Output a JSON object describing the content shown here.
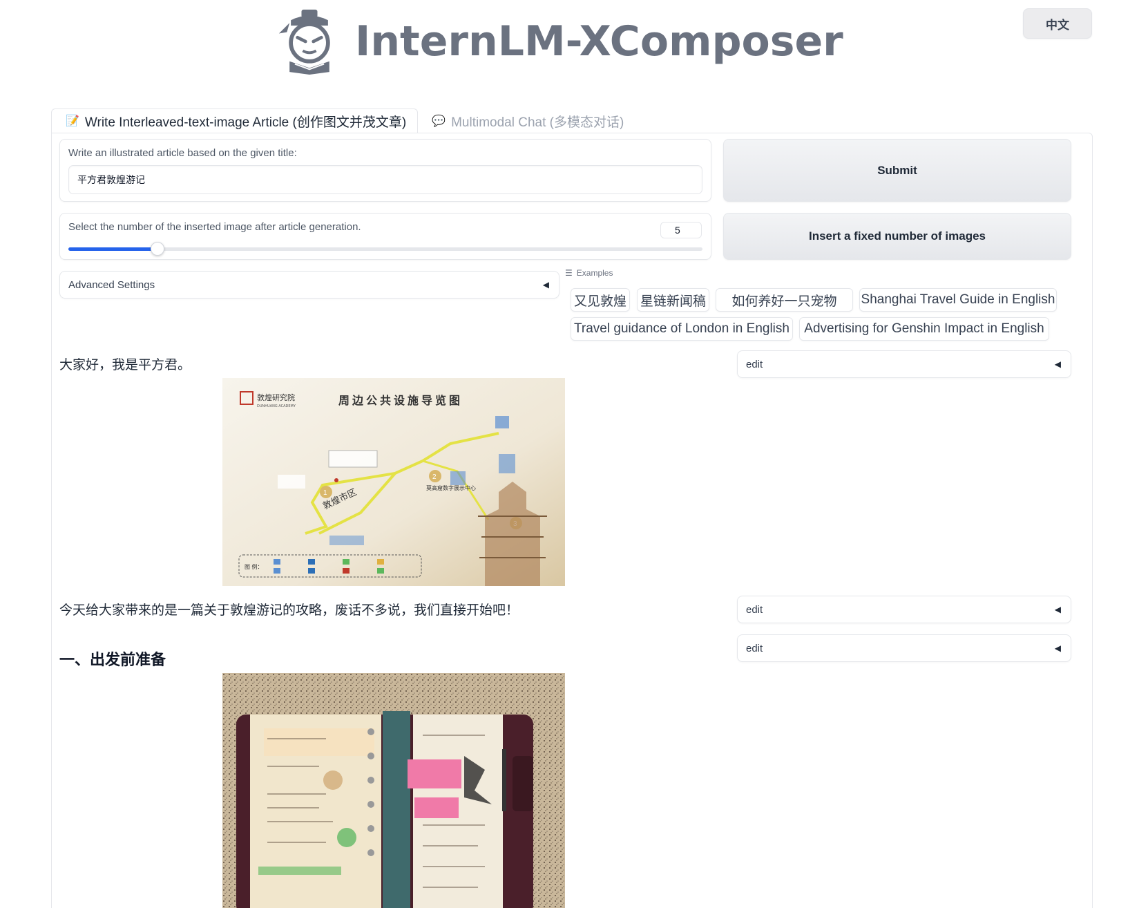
{
  "header": {
    "app_title": "InternLM-XComposer",
    "lang_button": "中文"
  },
  "tabs": [
    {
      "label": "Write Interleaved-text-image Article (创作图文并茂文章)",
      "icon": "edit-note-icon",
      "active": true
    },
    {
      "label": "Multimodal Chat (多模态对话)",
      "icon": "chat-bubble-icon",
      "active": false
    }
  ],
  "title_input": {
    "label": "Write an illustrated article based on the given title:",
    "value": "平方君敦煌游记"
  },
  "submit_button": "Submit",
  "image_count": {
    "label": "Select the number of the inserted image after article generation.",
    "value": "5",
    "slider_fraction": 0.14
  },
  "insert_button": "Insert a fixed number of images",
  "advanced_settings": "Advanced Settings",
  "examples": {
    "label": "Examples",
    "items": [
      "又见敦煌",
      "星链新闻稿",
      "如何养好一只宠物",
      "Shanghai Travel Guide in English",
      "Travel guidance of London in English",
      "Advertising for Genshin Impact in English"
    ]
  },
  "article": {
    "paragraph_1": "大家好，我是平方君。",
    "map_image": {
      "org_name": "敦煌研究院",
      "org_name_en": "DUNHUANG ACADEMY",
      "title": "周边公共设施导览图",
      "district": "敦煌市区",
      "exhibition": "莫高窟数字展示中心",
      "legend_label": "图 例："
    },
    "paragraph_2": "今天给大家带来的是一篇关于敦煌游记的攻略，废话不多说，我们直接开始吧！",
    "heading_1": "一、出发前准备"
  },
  "edit_panels": [
    "edit",
    "edit",
    "edit"
  ],
  "colors": {
    "accent": "#2563eb",
    "border": "#e5e7eb",
    "button_bg": "#e5e7eb"
  }
}
